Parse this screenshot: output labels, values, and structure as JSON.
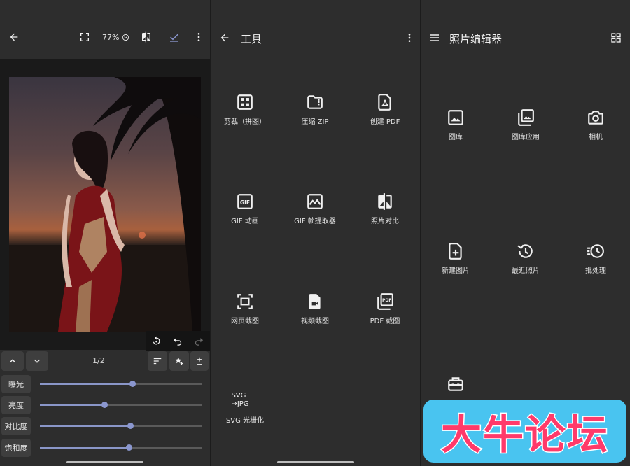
{
  "editor": {
    "zoom": "77%",
    "page_counter": "1/2",
    "sliders": [
      {
        "label": "曝光",
        "value": 0.57
      },
      {
        "label": "亮度",
        "value": 0.4
      },
      {
        "label": "对比度",
        "value": 0.56
      },
      {
        "label": "饱和度",
        "value": 0.55
      }
    ]
  },
  "tools": {
    "title": "工具",
    "items": [
      {
        "label": "剪裁（拼图）",
        "icon": "grid-collage-icon"
      },
      {
        "label": "压缩 ZIP",
        "icon": "zip-folder-icon"
      },
      {
        "label": "创建 PDF",
        "icon": "pdf-file-icon"
      },
      {
        "label": "GIF 动画",
        "icon": "gif-icon"
      },
      {
        "label": "GIF 帧提取器",
        "icon": "image-frame-icon"
      },
      {
        "label": "照片对比",
        "icon": "compare-icon"
      },
      {
        "label": "网页截图",
        "icon": "screenshot-icon"
      },
      {
        "label": "视频截图",
        "icon": "video-file-icon"
      },
      {
        "label": "PDF 截图",
        "icon": "pdf-stack-icon"
      }
    ],
    "svg_icon_line1": "SVG",
    "svg_icon_line2": "→JPG",
    "svg_label": "SVG 光栅化"
  },
  "home": {
    "title": "照片编辑器",
    "items": [
      {
        "label": "图库",
        "icon": "image-icon"
      },
      {
        "label": "图库应用",
        "icon": "gallery-stack-icon"
      },
      {
        "label": "相机",
        "icon": "camera-icon"
      },
      {
        "label": "新建图片",
        "icon": "new-file-icon"
      },
      {
        "label": "最近照片",
        "icon": "history-icon"
      },
      {
        "label": "批处理",
        "icon": "batch-clock-icon"
      }
    ]
  },
  "watermark": "大牛论坛",
  "colors": {
    "accent": "#8b97cf",
    "watermark_bg": "#49c4f0",
    "watermark_text": "#ff3a6a"
  }
}
